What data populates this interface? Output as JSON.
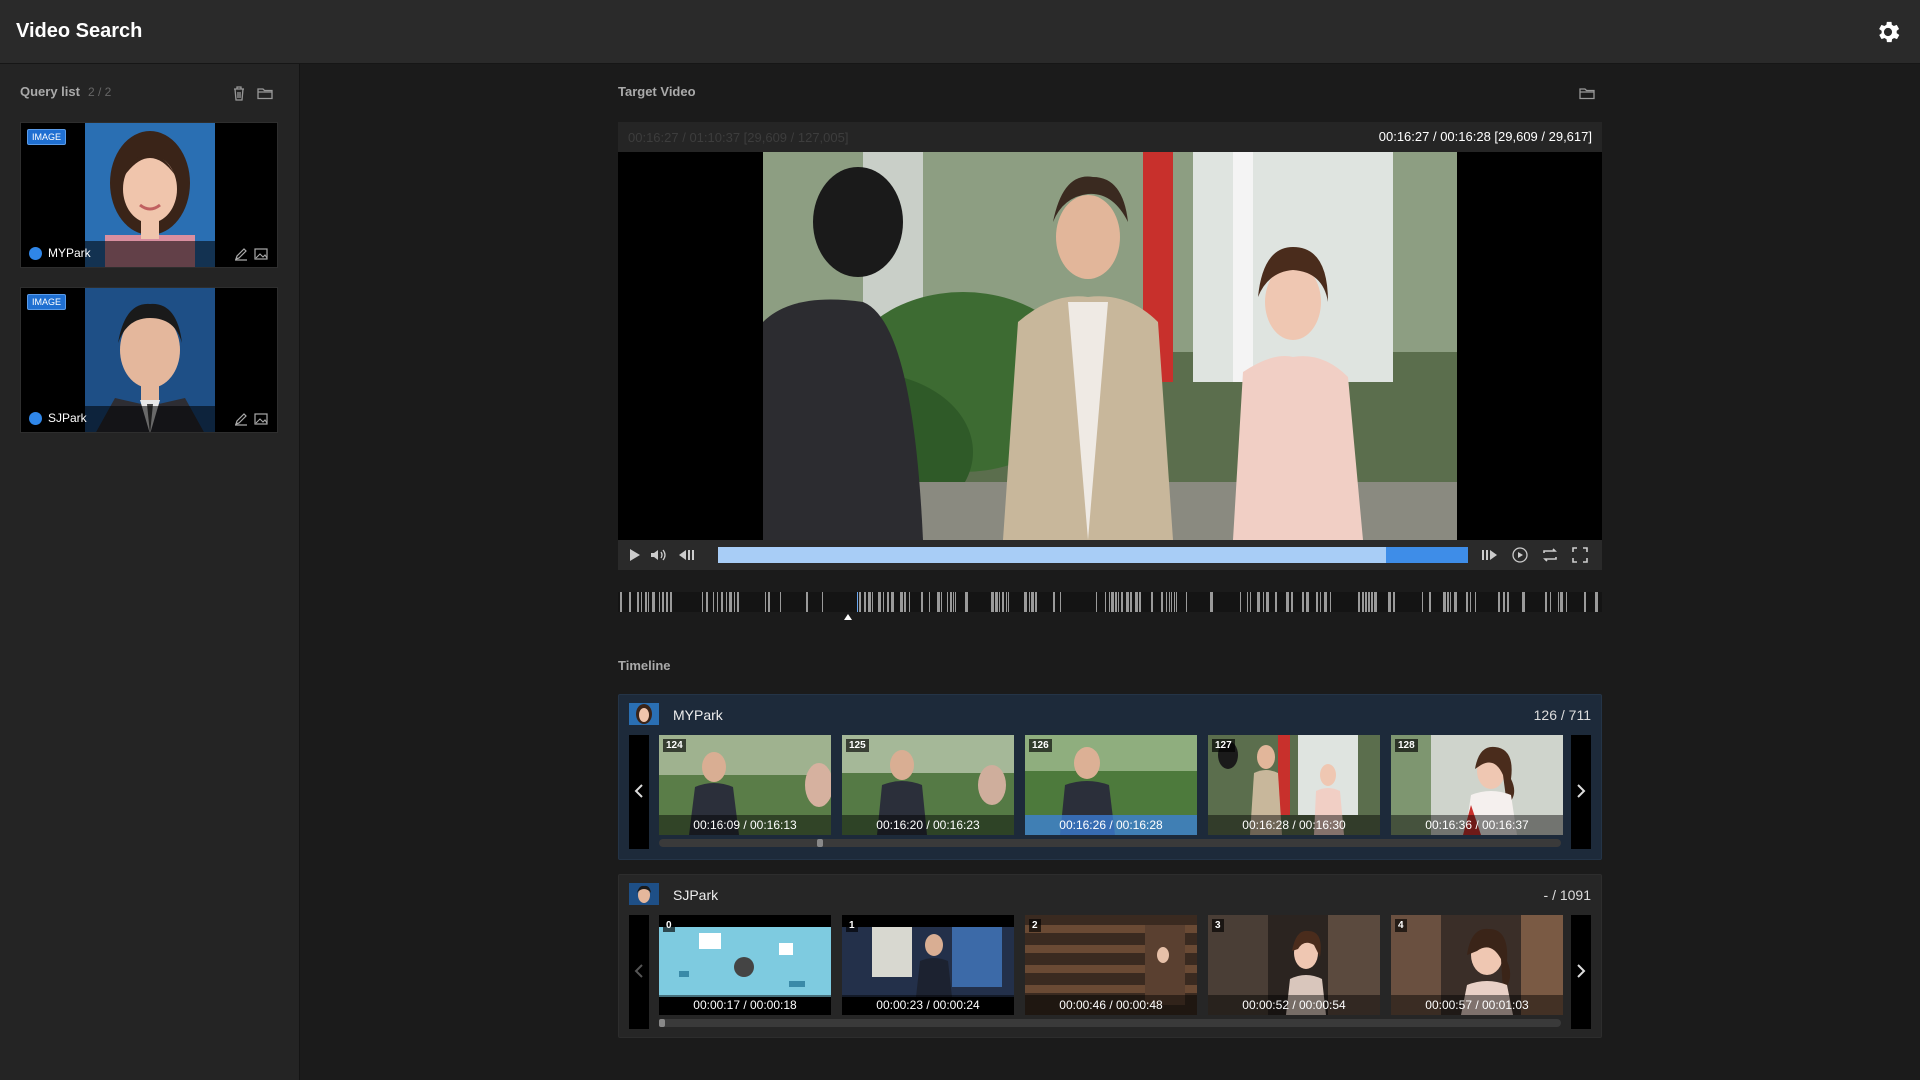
{
  "app": {
    "title": "Video Search"
  },
  "sidebar": {
    "title": "Query list",
    "count": "2 / 2",
    "items": [
      {
        "badge": "IMAGE",
        "name": "MYPark"
      },
      {
        "badge": "IMAGE",
        "name": "SJPark"
      }
    ]
  },
  "target": {
    "label": "Target Video",
    "info_left": "00:16:27 / 01:10:37  [29,609 / 127,005]",
    "info_right": "00:16:27 / 00:16:28  [29,609 / 29,617]",
    "progress_fraction": 0.89
  },
  "timeline": {
    "label": "Timeline",
    "tracks": [
      {
        "name": "MYPark",
        "count": "126 / 711",
        "thumbs": [
          {
            "num": "124",
            "time": "00:16:09 / 00:16:13"
          },
          {
            "num": "125",
            "time": "00:16:20 / 00:16:23"
          },
          {
            "num": "126",
            "time": "00:16:26 / 00:16:28"
          },
          {
            "num": "127",
            "time": "00:16:28 / 00:16:30"
          },
          {
            "num": "128",
            "time": "00:16:36 / 00:16:37"
          }
        ]
      },
      {
        "name": "SJPark",
        "count": "- / 1091",
        "thumbs": [
          {
            "num": "0",
            "time": "00:00:17 / 00:00:18"
          },
          {
            "num": "1",
            "time": "00:00:23 / 00:00:24"
          },
          {
            "num": "2",
            "time": "00:00:46 / 00:00:48"
          },
          {
            "num": "3",
            "time": "00:00:52 / 00:00:54"
          },
          {
            "num": "4",
            "time": "00:00:57 / 00:01:03"
          }
        ]
      }
    ]
  },
  "colors": {
    "accent": "#3e8de8",
    "progress_played": "#a8cdf6",
    "panel_active": "#1d2a3a"
  },
  "icons": [
    "gear-icon",
    "trash-icon",
    "folder-icon",
    "edit-icon",
    "image-icon",
    "play-icon",
    "volume-icon",
    "step-back-icon",
    "step-forward-icon",
    "speed-icon",
    "repeat-icon",
    "fullscreen-icon",
    "chevron-left-icon",
    "chevron-right-icon"
  ]
}
